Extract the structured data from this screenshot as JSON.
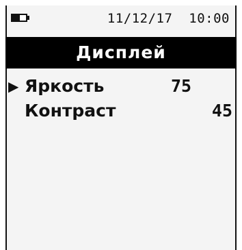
{
  "status": {
    "battery_icon": "battery-low-icon",
    "battery_level": 0.55,
    "date": "11/12/17",
    "time": "10:00"
  },
  "header": {
    "title": "Дисплей"
  },
  "menu": {
    "selector_icon": "triangle-right-icon",
    "selector_glyph": "▶",
    "items": [
      {
        "label": "Яркость",
        "value": "75",
        "selected": true
      },
      {
        "label": "Контраст",
        "value": "45",
        "selected": false
      }
    ]
  },
  "colors": {
    "title_bg": "#000000",
    "title_fg": "#ffffff",
    "text": "#111111",
    "screen_bg": "#f4f4f4"
  }
}
